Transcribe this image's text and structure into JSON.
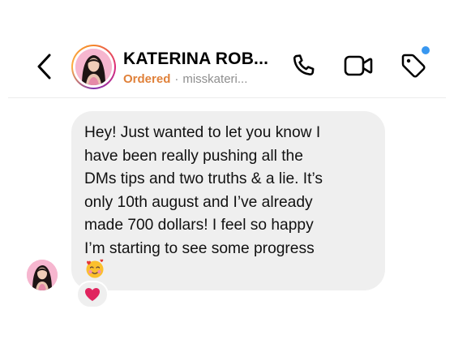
{
  "header": {
    "contact_name": "KATERINA ROB...",
    "status": "Ordered",
    "separator": "·",
    "handle": "misskateri..."
  },
  "icons": {
    "back": "chevron-left-icon",
    "phone": "phone-icon",
    "video": "video-camera-icon",
    "tag": "tag-icon",
    "notification_badge_color": "#3897f0"
  },
  "colors": {
    "status": "#e0813a",
    "bubble": "#efefef",
    "heart": "#e0245e"
  },
  "message": {
    "text": "Hey! Just wanted to let you know I\nhave been really pushing all the\nDMs tips and two truths & a lie. It’s\nonly 10th august and I’ve already\nmade 700 dollars! I feel so happy\nI’m starting to see some progress",
    "trailing_emoji": "smiling-face-with-hearts",
    "reaction": "red-heart"
  }
}
